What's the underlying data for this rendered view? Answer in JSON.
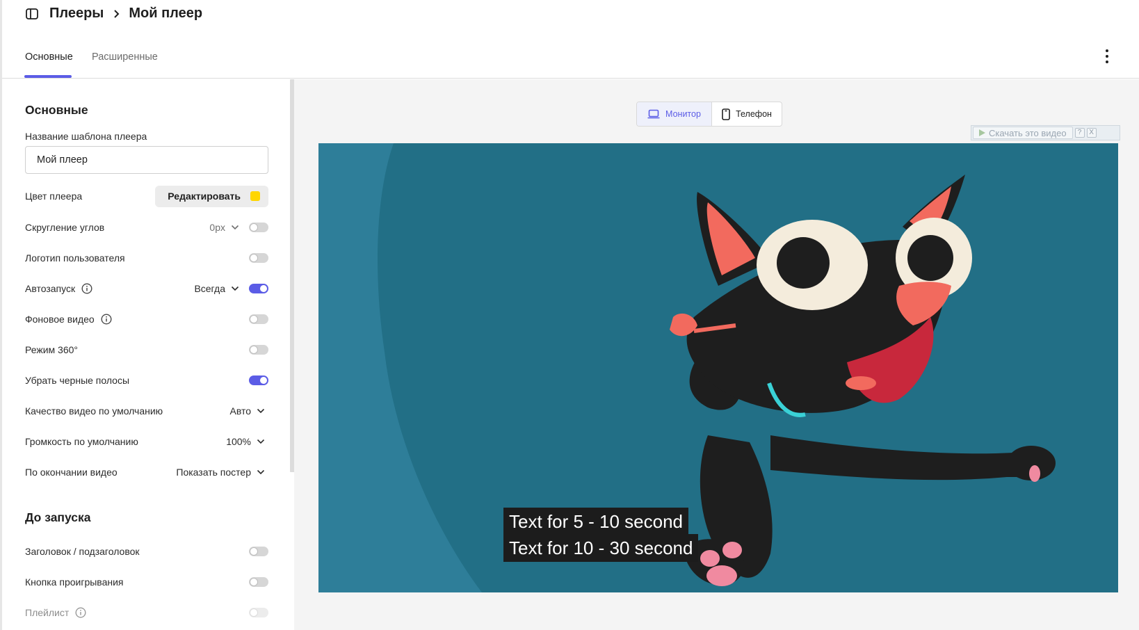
{
  "header": {
    "breadcrumb_root": "Плееры",
    "breadcrumb_current": "Мой плеер"
  },
  "tabs": [
    {
      "label": "Основные",
      "active": true
    },
    {
      "label": "Расширенные",
      "active": false
    }
  ],
  "panel": {
    "section_main_title": "Основные",
    "template_name_label": "Название шаблона плеера",
    "template_name_value": "Мой плеер",
    "player_color_label": "Цвет плеера",
    "edit_button_label": "Редактировать",
    "player_color": "#FFD600",
    "corner_rounding_label": "Скругление углов",
    "corner_rounding_value": "0px",
    "corner_rounding_on": false,
    "user_logo_label": "Логотип пользователя",
    "user_logo_on": false,
    "autoplay_label": "Автозапуск",
    "autoplay_value": "Всегда",
    "autoplay_on": true,
    "background_video_label": "Фоновое видео",
    "background_video_on": false,
    "mode360_label": "Режим 360°",
    "mode360_on": false,
    "remove_black_bars_label": "Убрать черные полосы",
    "remove_black_bars_on": true,
    "default_quality_label": "Качество видео по умолчанию",
    "default_quality_value": "Авто",
    "default_volume_label": "Громкость по умолчанию",
    "default_volume_value": "100%",
    "on_end_label": "По окончании видео",
    "on_end_value": "Показать постер",
    "section_prelaunch_title": "До запуска",
    "title_subtitle_label": "Заголовок / подзаголовок",
    "title_subtitle_on": false,
    "play_button_label": "Кнопка проигрывания",
    "play_button_on": false,
    "playlist_label": "Плейлист",
    "playlist_on": false
  },
  "preview": {
    "device_monitor": "Монитор",
    "device_phone": "Телефон",
    "download_label": "Скачать это видео",
    "download_help": "?",
    "download_close": "X",
    "subtitle_line1": "Text for 5 - 10 second",
    "subtitle_line2": "Text for 10 - 30 second"
  },
  "colors": {
    "accent": "#5B5CE6",
    "video_bg": "#226F86"
  }
}
